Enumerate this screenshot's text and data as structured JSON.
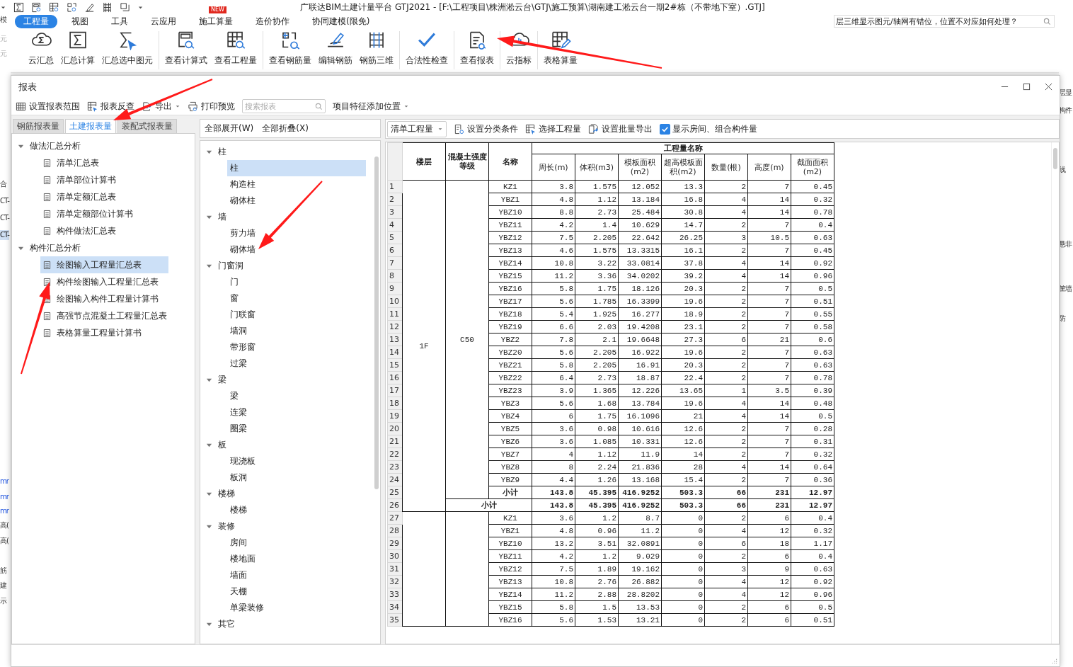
{
  "window": {
    "title": "广联达BIM土建计量平台 GTJ2021 - [F:\\工程项目\\株洲淞云台\\GTJ\\施工预算\\湖南建工淞云台一期2#栋（不带地下室）.GTJ]"
  },
  "menu": {
    "tabs": [
      {
        "label": "工程量",
        "selected": true
      },
      {
        "label": "视图",
        "selected": false
      },
      {
        "label": "工具",
        "selected": false
      },
      {
        "label": "云应用",
        "selected": false
      },
      {
        "label": "施工算量",
        "selected": false,
        "badge": "NEW"
      },
      {
        "label": "造价协作",
        "selected": false
      },
      {
        "label": "协同建模(限免)",
        "selected": false
      }
    ],
    "help_search": {
      "value": "层三维显示图元/轴网有错位，位置不对应如何处理？"
    }
  },
  "ribbon": {
    "groups": [
      [
        "云汇总",
        "汇总计算",
        "汇总选中图元"
      ],
      [
        "查看计算式",
        "查看工程量"
      ],
      [
        "查看钢筋量",
        "编辑钢筋",
        "钢筋三维"
      ],
      [
        "合法性检查"
      ],
      [
        "查看报表"
      ],
      [
        "云指标"
      ],
      [
        "表格算量"
      ]
    ]
  },
  "background_fragments": {
    "left": [
      {
        "text": "模",
        "kind": "text"
      },
      {
        "text": "元",
        "kind": "muted"
      },
      {
        "text": "元",
        "kind": "muted"
      },
      {
        "text": "合",
        "kind": "text"
      },
      {
        "text": "CT-",
        "kind": "text"
      },
      {
        "text": "CT-",
        "kind": "text"
      },
      {
        "text": "CT-",
        "kind": "highlight"
      },
      {
        "text": "mr",
        "kind": "link"
      },
      {
        "text": "mr",
        "kind": "link"
      },
      {
        "text": "mr",
        "kind": "link"
      },
      {
        "text": "高(",
        "kind": "text"
      },
      {
        "text": "高(",
        "kind": "text"
      },
      {
        "text": "筋",
        "kind": "text"
      },
      {
        "text": "建",
        "kind": "text"
      },
      {
        "text": "示",
        "kind": "text"
      }
    ],
    "right": [
      {
        "text": "层显",
        "kind": "text"
      },
      {
        "text": "构件",
        "kind": "text"
      },
      {
        "text": "线",
        "kind": "text"
      },
      {
        "text": "悬非",
        "kind": "text"
      },
      {
        "text": "筐墙",
        "kind": "text"
      },
      {
        "text": "防",
        "kind": "text"
      }
    ]
  },
  "dialog": {
    "title": "报表",
    "toolbar": {
      "buttons": [
        "设置报表范围",
        "报表反查",
        "导出",
        "打印预览"
      ],
      "search": {
        "placeholder": "搜索报表"
      },
      "position_menu": "项目特征添加位置"
    },
    "report_tabs": [
      {
        "label": "钢筋报表量",
        "selected": false
      },
      {
        "label": "土建报表量",
        "selected": true
      },
      {
        "label": "装配式报表量",
        "selected": false
      }
    ],
    "report_tree": [
      {
        "label": "做法汇总分析",
        "expanded": true,
        "children": [
          {
            "label": "清单汇总表",
            "selected": false
          },
          {
            "label": "清单部位计算书",
            "selected": false
          },
          {
            "label": "清单定额汇总表",
            "selected": false
          },
          {
            "label": "清单定额部位计算书",
            "selected": false
          },
          {
            "label": "构件做法汇总表",
            "selected": false
          }
        ]
      },
      {
        "label": "构件汇总分析",
        "expanded": true,
        "children": [
          {
            "label": "绘图输入工程量汇总表",
            "selected": true
          },
          {
            "label": "构件绘图输入工程量汇总表",
            "selected": false
          },
          {
            "label": "绘图输入构件工程量计算书",
            "selected": false
          },
          {
            "label": "高强节点混凝土工程量汇总表",
            "selected": false
          },
          {
            "label": "表格算量工程量计算书",
            "selected": false
          }
        ]
      }
    ],
    "component_actions": [
      "全部展开(W)",
      "全部折叠(X)"
    ],
    "component_tree": [
      {
        "label": "柱",
        "expanded": true,
        "children": [
          {
            "label": "柱",
            "selected": true
          },
          {
            "label": "构造柱",
            "selected": false
          },
          {
            "label": "砌体柱",
            "selected": false
          }
        ]
      },
      {
        "label": "墙",
        "expanded": true,
        "children": [
          {
            "label": "剪力墙",
            "selected": false
          },
          {
            "label": "砌体墙",
            "selected": false
          }
        ]
      },
      {
        "label": "门窗洞",
        "expanded": true,
        "children": [
          {
            "label": "门",
            "selected": false
          },
          {
            "label": "窗",
            "selected": false
          },
          {
            "label": "门联窗",
            "selected": false
          },
          {
            "label": "墙洞",
            "selected": false
          },
          {
            "label": "带形窗",
            "selected": false
          },
          {
            "label": "过梁",
            "selected": false
          }
        ]
      },
      {
        "label": "梁",
        "expanded": true,
        "children": [
          {
            "label": "梁",
            "selected": false
          },
          {
            "label": "连梁",
            "selected": false
          },
          {
            "label": "圈梁",
            "selected": false
          }
        ]
      },
      {
        "label": "板",
        "expanded": true,
        "children": [
          {
            "label": "现浇板",
            "selected": false
          },
          {
            "label": "板洞",
            "selected": false
          }
        ]
      },
      {
        "label": "楼梯",
        "expanded": true,
        "children": [
          {
            "label": "楼梯",
            "selected": false
          }
        ]
      },
      {
        "label": "装修",
        "expanded": true,
        "children": [
          {
            "label": "房间",
            "selected": false
          },
          {
            "label": "楼地面",
            "selected": false
          },
          {
            "label": "墙面",
            "selected": false
          },
          {
            "label": "天棚",
            "selected": false
          },
          {
            "label": "单梁装修",
            "selected": false
          }
        ]
      },
      {
        "label": "其它",
        "expanded": true
      }
    ],
    "sheet_toolbar": {
      "mode": "清单工程量",
      "buttons": [
        "设置分类条件",
        "选择工程量",
        "设置批量导出"
      ],
      "show_rooms": {
        "label": "显示房间、组合构件量",
        "checked": true
      }
    },
    "sheet": {
      "fixed_columns": [
        "楼层",
        "混凝土强度等级",
        "名称"
      ],
      "group_header": "工程量名称",
      "columns": [
        "周长(m)",
        "体积(m3)",
        "模板面积(m2)",
        "超高模板面积(m2)",
        "数量(根)",
        "高度(m)",
        "截面面积(m2)"
      ],
      "row_numbers": [
        "1",
        "2",
        "3",
        "4",
        "5",
        "6",
        "7",
        "8",
        "9",
        "10",
        "11",
        "12",
        "13",
        "14",
        "15",
        "16",
        "17",
        "18",
        "19",
        "20",
        "21",
        "22",
        "23",
        "24",
        "25",
        "26",
        "27",
        "28",
        "29",
        "30",
        "31",
        "32",
        "33",
        "34",
        "35"
      ],
      "floors": [
        {
          "floor": "1F",
          "grades": [
            {
              "grade": "C50",
              "rows": [
                [
                  "KZ1",
                  "3.8",
                  "1.575",
                  "12.052",
                  "13.3",
                  "2",
                  "7",
                  "0.45"
                ],
                [
                  "YBZ1",
                  "4.8",
                  "1.12",
                  "13.184",
                  "16.8",
                  "4",
                  "14",
                  "0.32"
                ],
                [
                  "YBZ10",
                  "8.8",
                  "2.73",
                  "25.484",
                  "30.8",
                  "4",
                  "14",
                  "0.78"
                ],
                [
                  "YBZ11",
                  "4.2",
                  "1.4",
                  "10.629",
                  "14.7",
                  "2",
                  "7",
                  "0.4"
                ],
                [
                  "YBZ12",
                  "7.5",
                  "2.205",
                  "22.642",
                  "26.25",
                  "3",
                  "10.5",
                  "0.63"
                ],
                [
                  "YBZ13",
                  "4.6",
                  "1.575",
                  "13.3315",
                  "16.1",
                  "2",
                  "7",
                  "0.45"
                ],
                [
                  "YBZ14",
                  "10.8",
                  "3.22",
                  "33.0814",
                  "37.8",
                  "4",
                  "14",
                  "0.92"
                ],
                [
                  "YBZ15",
                  "11.2",
                  "3.36",
                  "34.0202",
                  "39.2",
                  "4",
                  "14",
                  "0.96"
                ],
                [
                  "YBZ16",
                  "5.8",
                  "1.75",
                  "18.126",
                  "20.3",
                  "2",
                  "7",
                  "0.5"
                ],
                [
                  "YBZ17",
                  "5.6",
                  "1.785",
                  "16.3399",
                  "19.6",
                  "2",
                  "7",
                  "0.51"
                ],
                [
                  "YBZ18",
                  "5.4",
                  "1.925",
                  "16.277",
                  "18.9",
                  "2",
                  "7",
                  "0.55"
                ],
                [
                  "YBZ19",
                  "6.6",
                  "2.03",
                  "19.4208",
                  "23.1",
                  "2",
                  "7",
                  "0.58"
                ],
                [
                  "YBZ2",
                  "7.8",
                  "2.1",
                  "19.6648",
                  "27.3",
                  "6",
                  "21",
                  "0.6"
                ],
                [
                  "YBZ20",
                  "5.6",
                  "2.205",
                  "16.922",
                  "19.6",
                  "2",
                  "7",
                  "0.63"
                ],
                [
                  "YBZ21",
                  "5.8",
                  "2.205",
                  "16.91",
                  "20.3",
                  "2",
                  "7",
                  "0.63"
                ],
                [
                  "YBZ22",
                  "6.4",
                  "2.73",
                  "18.87",
                  "22.4",
                  "2",
                  "7",
                  "0.78"
                ],
                [
                  "YBZ23",
                  "3.9",
                  "1.365",
                  "12.226",
                  "13.65",
                  "1",
                  "3.5",
                  "0.39"
                ],
                [
                  "YBZ3",
                  "5.6",
                  "1.68",
                  "13.784",
                  "19.6",
                  "4",
                  "14",
                  "0.48"
                ],
                [
                  "YBZ4",
                  "6",
                  "1.75",
                  "16.1096",
                  "21",
                  "4",
                  "14",
                  "0.5"
                ],
                [
                  "YBZ5",
                  "3.6",
                  "0.98",
                  "10.616",
                  "12.6",
                  "2",
                  "7",
                  "0.28"
                ],
                [
                  "YBZ6",
                  "3.6",
                  "1.085",
                  "10.331",
                  "12.6",
                  "2",
                  "7",
                  "0.31"
                ],
                [
                  "YBZ7",
                  "4",
                  "1.12",
                  "11.9",
                  "14",
                  "2",
                  "7",
                  "0.32"
                ],
                [
                  "YBZ8",
                  "8",
                  "2.24",
                  "21.836",
                  "28",
                  "4",
                  "14",
                  "0.64"
                ],
                [
                  "YBZ9",
                  "4.4",
                  "1.26",
                  "13.168",
                  "15.4",
                  "2",
                  "7",
                  "0.36"
                ]
              ],
              "total": [
                "小计",
                "143.8",
                "45.395",
                "416.9252",
                "503.3",
                "66",
                "231",
                "12.97"
              ]
            }
          ],
          "total": [
            "小计",
            "143.8",
            "45.395",
            "416.9252",
            "503.3",
            "66",
            "231",
            "12.97"
          ]
        },
        {
          "grades": [
            {
              "rows": [
                [
                  "KZ1",
                  "3.6",
                  "1.2",
                  "8.7",
                  "0",
                  "2",
                  "6",
                  "0.4"
                ],
                [
                  "YBZ1",
                  "4.8",
                  "0.96",
                  "11.2",
                  "0",
                  "4",
                  "12",
                  "0.32"
                ],
                [
                  "YBZ10",
                  "13.2",
                  "3.51",
                  "32.0891",
                  "0",
                  "6",
                  "18",
                  "1.17"
                ],
                [
                  "YBZ11",
                  "4.2",
                  "1.2",
                  "9.029",
                  "0",
                  "2",
                  "6",
                  "0.4"
                ],
                [
                  "YBZ12",
                  "7.5",
                  "1.89",
                  "19.162",
                  "0",
                  "3",
                  "9",
                  "0.63"
                ],
                [
                  "YBZ13",
                  "10.8",
                  "2.76",
                  "26.882",
                  "0",
                  "4",
                  "12",
                  "0.92"
                ],
                [
                  "YBZ14",
                  "11.2",
                  "2.88",
                  "28.8202",
                  "0",
                  "4",
                  "12",
                  "0.96"
                ],
                [
                  "YBZ15",
                  "5.8",
                  "1.5",
                  "13.53",
                  "0",
                  "2",
                  "6",
                  "0.5"
                ],
                [
                  "YBZ16",
                  "5.6",
                  "1.53",
                  "13.21",
                  "0",
                  "2",
                  "6",
                  "0.51"
                ]
              ]
            }
          ]
        }
      ]
    }
  }
}
